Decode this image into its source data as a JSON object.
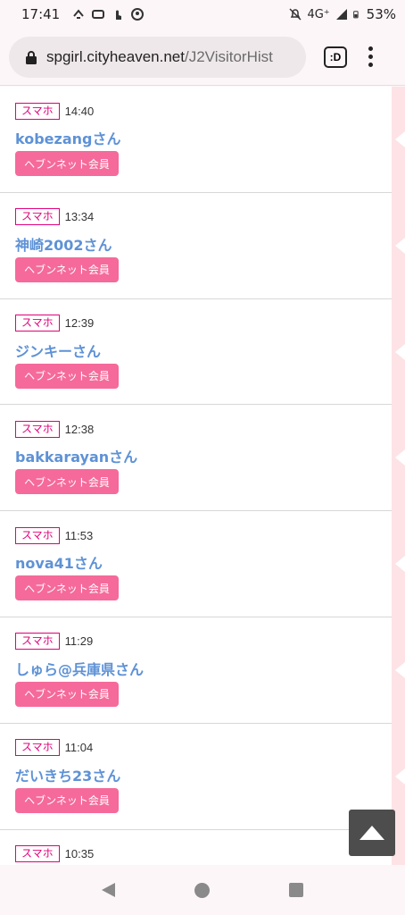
{
  "status_bar": {
    "time": "17:41",
    "network": "4G⁺",
    "battery": "53%"
  },
  "browser": {
    "url_domain": "spgirl.cityheaven.net",
    "url_path": "/J2VisitorHist",
    "tab_switcher_label": ":D"
  },
  "visitors": [
    {
      "device": "スマホ",
      "time": "14:40",
      "name": "kobezangさん",
      "member": "ヘブンネット会員"
    },
    {
      "device": "スマホ",
      "time": "13:34",
      "name": "神崎2002さん",
      "member": "ヘブンネット会員"
    },
    {
      "device": "スマホ",
      "time": "12:39",
      "name": "ジンキーさん",
      "member": "ヘブンネット会員"
    },
    {
      "device": "スマホ",
      "time": "12:38",
      "name": "bakkarayanさん",
      "member": "ヘブンネット会員"
    },
    {
      "device": "スマホ",
      "time": "11:53",
      "name": "nova41さん",
      "member": "ヘブンネット会員"
    },
    {
      "device": "スマホ",
      "time": "11:29",
      "name": "しゅら@兵庫県さん",
      "member": "ヘブンネット会員"
    },
    {
      "device": "スマホ",
      "time": "11:04",
      "name": "だいきち23さん",
      "member": "ヘブンネット会員"
    },
    {
      "device": "スマホ",
      "time": "10:35",
      "name": "",
      "member": ""
    }
  ]
}
